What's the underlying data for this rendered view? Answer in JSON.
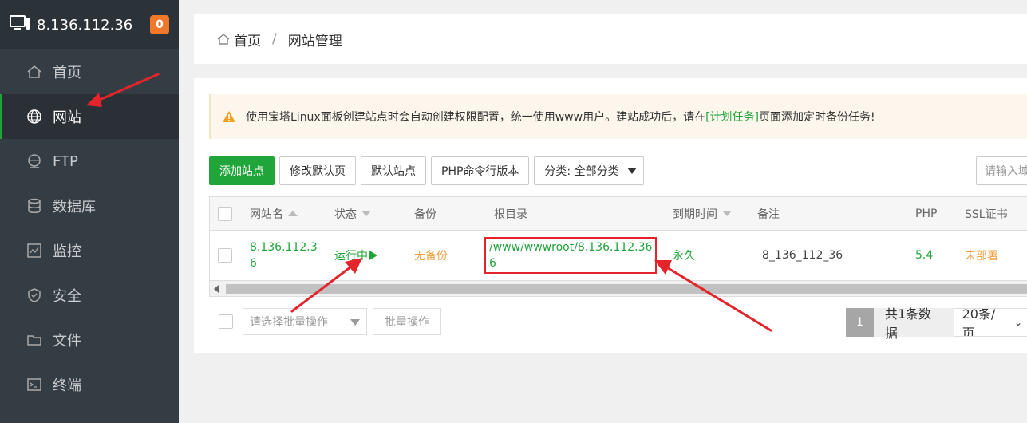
{
  "sidebar": {
    "server_ip": "8.136.112.36",
    "badge": "0",
    "items": [
      {
        "label": "首页",
        "icon": "home-icon"
      },
      {
        "label": "网站",
        "icon": "globe-icon"
      },
      {
        "label": "FTP",
        "icon": "ftp-icon"
      },
      {
        "label": "数据库",
        "icon": "database-icon"
      },
      {
        "label": "监控",
        "icon": "monitor-icon"
      },
      {
        "label": "安全",
        "icon": "shield-icon"
      },
      {
        "label": "文件",
        "icon": "folder-icon"
      },
      {
        "label": "终端",
        "icon": "terminal-icon"
      }
    ]
  },
  "breadcrumb": {
    "home": "首页",
    "sep": "/",
    "current": "网站管理"
  },
  "notice": {
    "text_before": "使用宝塔Linux面板创建站点时会自动创建权限配置，统一使用www用户。建站成功后，请在",
    "link": "[计划任务]",
    "text_after": "页面添加定时备份任务!"
  },
  "toolbar": {
    "add_site": "添加站点",
    "edit_default_page": "修改默认页",
    "default_site": "默认站点",
    "php_cli": "PHP命令行版本",
    "category": "分类: 全部分类",
    "search_placeholder": "请输入域名或备注"
  },
  "table": {
    "headers": {
      "name": "网站名",
      "status": "状态",
      "backup": "备份",
      "root": "根目录",
      "expire": "到期时间",
      "remark": "备注",
      "php": "PHP",
      "ssl": "SSL证书"
    },
    "rows": [
      {
        "name_line1": "8.136.112.3",
        "name_line2": "6",
        "status": "运行中",
        "backup": "无备份",
        "root_line1": "/www/wwwroot/8.136.112.36",
        "root_line2": "6",
        "expire": "永久",
        "remark": "8_136_112_36",
        "php": "5.4",
        "ssl": "未部署"
      }
    ]
  },
  "bottom": {
    "batch_placeholder": "请选择批量操作",
    "batch_button": "批量操作",
    "page": "1",
    "total": "共1条数据",
    "page_size": "20条/页"
  },
  "colors": {
    "accent": "#20a53a",
    "warning": "#f0a040",
    "annotation": "#e3252b",
    "sidebar": "#353d44"
  }
}
